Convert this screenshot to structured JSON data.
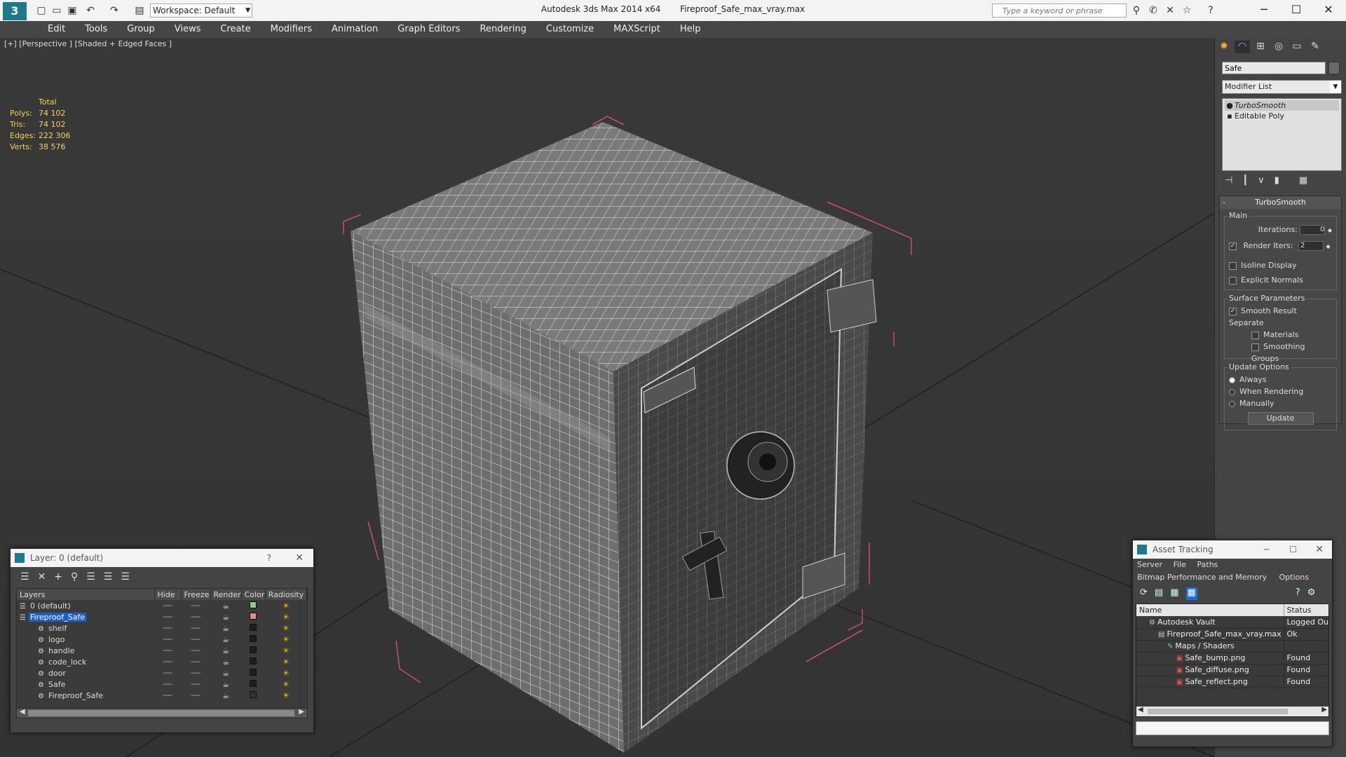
{
  "app": {
    "title": "Autodesk 3ds Max  2014 x64",
    "file": "Fireproof_Safe_max_vray.max",
    "workspace": "Workspace: Default",
    "search_placeholder": "Type a keyword or phrase"
  },
  "menu": [
    "Edit",
    "Tools",
    "Group",
    "Views",
    "Create",
    "Modifiers",
    "Animation",
    "Graph Editors",
    "Rendering",
    "Customize",
    "MAXScript",
    "Help"
  ],
  "viewport": {
    "label": "[+] [Perspective ] [Shaded + Edged Faces ]",
    "stats_header": "Total",
    "stats": [
      {
        "label": "Polys:",
        "value": "74 102"
      },
      {
        "label": "Tris:",
        "value": "74 102"
      },
      {
        "label": "Edges:",
        "value": "222 306"
      },
      {
        "label": "Verts:",
        "value": "38 576"
      }
    ]
  },
  "command_panel": {
    "object_name": "Safe",
    "modifier_list": "Modifier List",
    "stack": [
      "TurboSmooth",
      "Editable Poly"
    ],
    "rollout_title": "TurboSmooth",
    "main_group": "Main",
    "iterations_label": "Iterations:",
    "iterations_value": "0",
    "render_iters_label": "Render Iters:",
    "render_iters_value": "2",
    "isoline_display": "Isoline Display",
    "explicit_normals": "Explicit Normals",
    "surface_params": "Surface Parameters",
    "smooth_result": "Smooth Result",
    "separate": "Separate",
    "materials": "Materials",
    "smoothing_groups": "Smoothing Groups",
    "update_options": "Update Options",
    "always": "Always",
    "when_rendering": "When Rendering",
    "manually": "Manually",
    "update_button": "Update"
  },
  "layer_dialog": {
    "title": "Layer: 0 (default)",
    "help": "?",
    "columns": [
      "Layers",
      "Hide",
      "Freeze",
      "Render",
      "Color",
      "Radiosity"
    ],
    "rows": [
      {
        "name": "0 (default)",
        "color": "#7ed37e",
        "level": 0,
        "selected": false
      },
      {
        "name": "Fireproof_Safe",
        "color": "#e88a8a",
        "level": 0,
        "selected": true
      },
      {
        "name": "shelf",
        "color": "#1e1e1e",
        "level": 1,
        "selected": false
      },
      {
        "name": "logo",
        "color": "#1e1e1e",
        "level": 1,
        "selected": false
      },
      {
        "name": "handle",
        "color": "#1e1e1e",
        "level": 1,
        "selected": false
      },
      {
        "name": "code_lock",
        "color": "#1e1e1e",
        "level": 1,
        "selected": false
      },
      {
        "name": "door",
        "color": "#1e1e1e",
        "level": 1,
        "selected": false
      },
      {
        "name": "Safe",
        "color": "#1e1e1e",
        "level": 1,
        "selected": false
      },
      {
        "name": "Fireproof_Safe",
        "color": "#333333",
        "level": 1,
        "selected": false
      }
    ]
  },
  "asset_dialog": {
    "title": "Asset Tracking",
    "menu": [
      "Server",
      "File",
      "Paths"
    ],
    "menu2": [
      "Bitmap Performance and Memory",
      "Options"
    ],
    "columns": [
      "Name",
      "Status"
    ],
    "rows": [
      {
        "name": "Autodesk Vault",
        "status": "Logged Ou",
        "level": 0
      },
      {
        "name": "Fireproof_Safe_max_vray.max",
        "status": "Ok",
        "level": 1
      },
      {
        "name": "Maps / Shaders",
        "status": "",
        "level": 2
      },
      {
        "name": "Safe_bump.png",
        "status": "Found",
        "level": 3
      },
      {
        "name": "Safe_diffuse.png",
        "status": "Found",
        "level": 3
      },
      {
        "name": "Safe_reflect.png",
        "status": "Found",
        "level": 3
      }
    ]
  },
  "colors": {
    "accent": "#1a6fd4",
    "selection": "#1f5fc4",
    "stat_yellow": "#f5d44a",
    "bbox_pink": "#e0507a"
  }
}
